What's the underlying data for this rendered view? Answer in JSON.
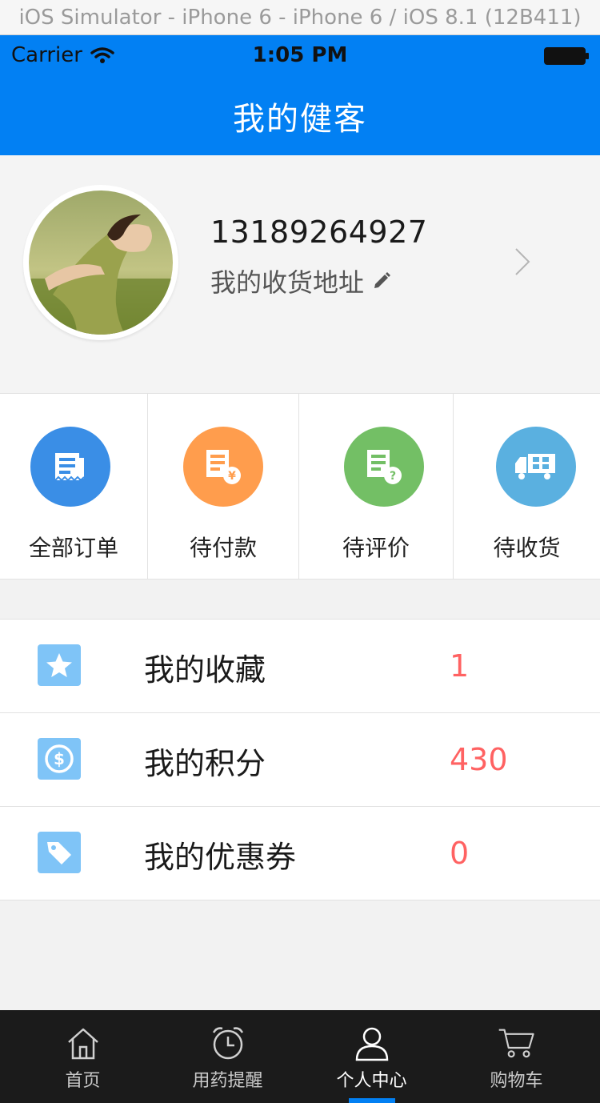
{
  "simulator": {
    "title": "iOS Simulator - iPhone 6 - iPhone 6 / iOS 8.1 (12B411)"
  },
  "status_bar": {
    "carrier": "Carrier",
    "time": "1:05 PM"
  },
  "nav": {
    "title": "我的健客"
  },
  "profile": {
    "phone": "13189264927",
    "address_label": "我的收货地址"
  },
  "orders": [
    {
      "label": "全部订单",
      "color": "#3a8ee6",
      "icon": "receipt-icon"
    },
    {
      "label": "待付款",
      "color": "#ff9d4d",
      "icon": "receipt-yen-icon"
    },
    {
      "label": "待评价",
      "color": "#73bf65",
      "icon": "receipt-question-icon"
    },
    {
      "label": "待收货",
      "color": "#5ab0e0",
      "icon": "truck-icon"
    }
  ],
  "menu": [
    {
      "label": "我的收藏",
      "count": "1",
      "icon": "star-icon"
    },
    {
      "label": "我的积分",
      "count": "430",
      "icon": "coin-icon"
    },
    {
      "label": "我的优惠券",
      "count": "0",
      "icon": "tag-icon"
    }
  ],
  "tabs": [
    {
      "label": "首页",
      "icon": "home-icon"
    },
    {
      "label": "用药提醒",
      "icon": "alarm-clock-icon"
    },
    {
      "label": "个人中心",
      "icon": "person-icon"
    },
    {
      "label": "购物车",
      "icon": "cart-icon"
    }
  ],
  "colors": {
    "primary": "#0280f3",
    "count_red": "#ff6262",
    "tabbar_bg": "#1b1b1b"
  }
}
